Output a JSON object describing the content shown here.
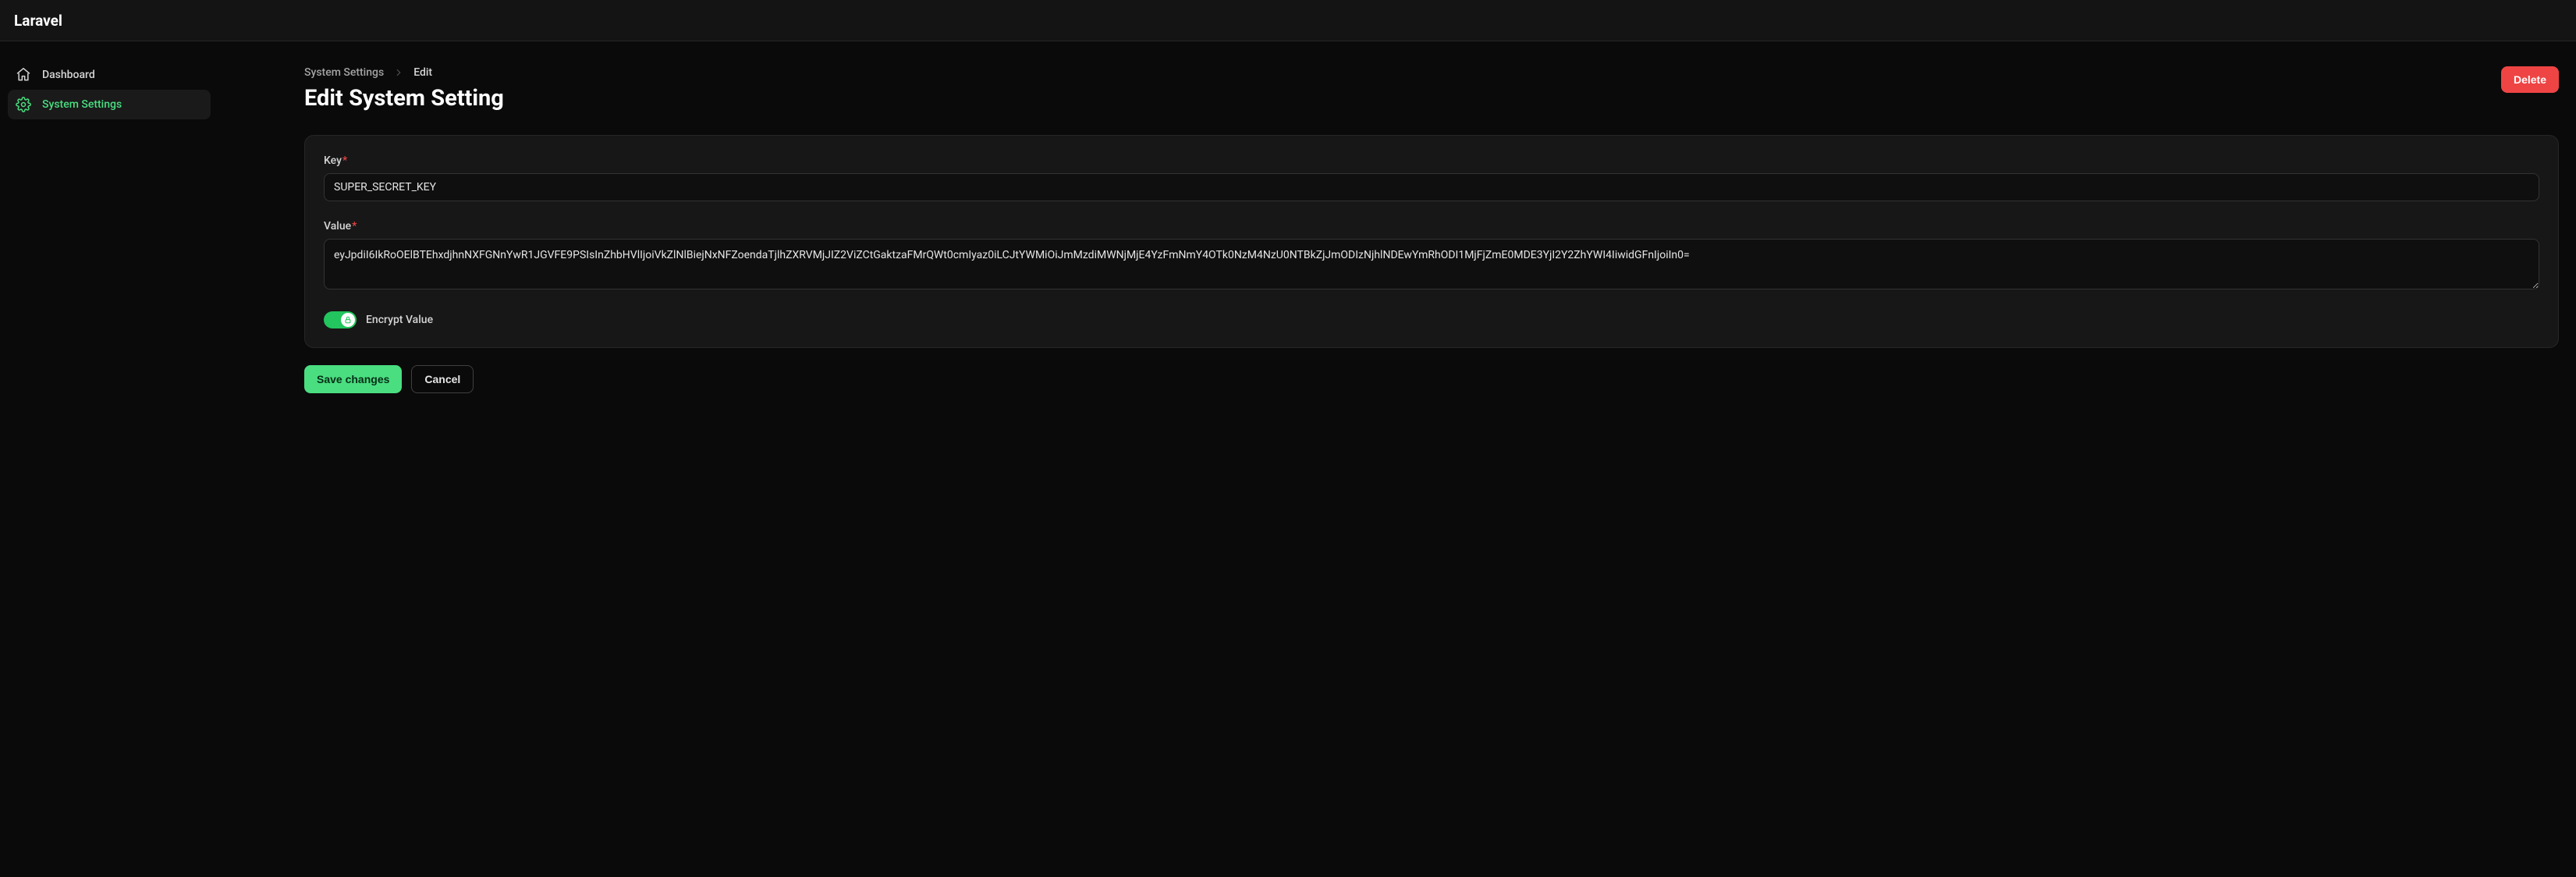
{
  "brand": "Laravel",
  "sidebar": {
    "items": [
      {
        "label": "Dashboard",
        "active": false
      },
      {
        "label": "System Settings",
        "active": true
      }
    ]
  },
  "breadcrumb": {
    "parent": "System Settings",
    "current": "Edit"
  },
  "page": {
    "title": "Edit System Setting"
  },
  "buttons": {
    "delete": "Delete",
    "save": "Save changes",
    "cancel": "Cancel"
  },
  "form": {
    "key_label": "Key",
    "key_value": "SUPER_SECRET_KEY",
    "value_label": "Value",
    "value_value": "eyJpdiI6IkRoOElBTEhxdjhnNXFGNnYwR1JGVFE9PSIsInZhbHVlIjoiVkZlNlBiejNxNFZoendaTjlhZXRVMjJIZ2ViZCtGaktzaFMrQWt0cmIyaz0iLCJtYWMiOiJmMzdiMWNjMjE4YzFmNmY4OTk0NzM4NzU0NTBkZjJmODIzNjhlNDEwYmRhODI1MjFjZmE0MDE3YjI2Y2ZhYWI4IiwidGFnIjoiIn0=",
    "encrypt_label": "Encrypt Value",
    "encrypt_on": true
  }
}
